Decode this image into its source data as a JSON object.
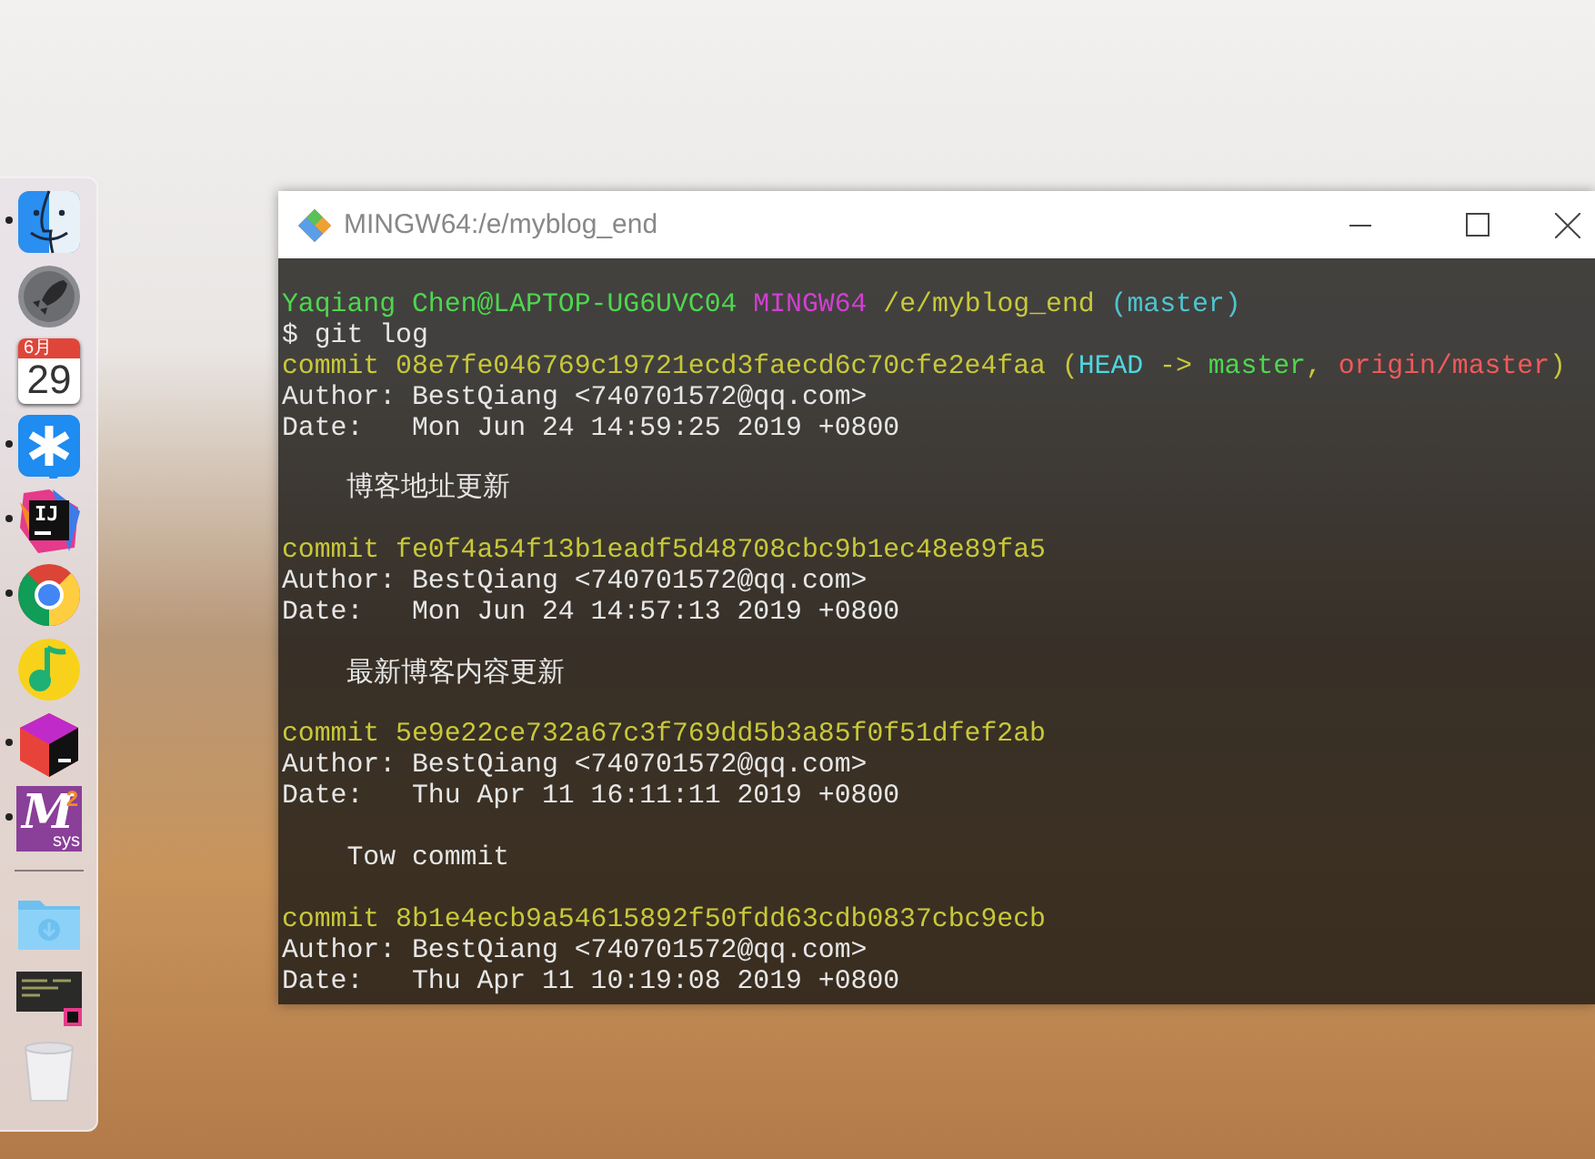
{
  "dock": {
    "items": [
      {
        "kind": "finder",
        "running": true
      },
      {
        "kind": "launchpad",
        "running": false
      },
      {
        "kind": "calendar",
        "running": false,
        "month": "6月",
        "day": "29"
      },
      {
        "kind": "dingtalk",
        "running": true
      },
      {
        "kind": "intellij",
        "running": true,
        "text": "IJ"
      },
      {
        "kind": "chrome",
        "running": true
      },
      {
        "kind": "music",
        "running": false
      },
      {
        "kind": "toolbox",
        "running": true
      },
      {
        "kind": "msys",
        "running": true,
        "text": "M",
        "sup": "2",
        "sub": "sys"
      },
      {
        "kind": "separator"
      },
      {
        "kind": "folder",
        "running": false
      },
      {
        "kind": "thumbnail",
        "running": false
      },
      {
        "kind": "trash",
        "running": false
      }
    ]
  },
  "terminal": {
    "title": "MINGW64:/e/myblog_end",
    "prompt": {
      "user_host": "Yaqiang Chen@LAPTOP-UG6UVC04",
      "system": "MINGW64",
      "path": "/e/myblog_end",
      "branch": "(master)"
    },
    "command": "$ git log",
    "commits": [
      {
        "label": "commit",
        "hash": "08e7fe046769c19721ecd3faecd6c70cfe2e4faa",
        "refs": [
          {
            "kind": "punct",
            "text": " ("
          },
          {
            "kind": "head",
            "text": "HEAD"
          },
          {
            "kind": "punct",
            "text": " -> "
          },
          {
            "kind": "local",
            "text": "master"
          },
          {
            "kind": "punct",
            "text": ", "
          },
          {
            "kind": "remote",
            "text": "origin/master"
          },
          {
            "kind": "punct",
            "text": ")"
          }
        ],
        "author": "Author: BestQiang <740701572@qq.com>",
        "date": "Date:   Mon Jun 24 14:59:25 2019 +0800",
        "message": "博客地址更新"
      },
      {
        "label": "commit",
        "hash": "fe0f4a54f13b1eadf5d48708cbc9b1ec48e89fa5",
        "author": "Author: BestQiang <740701572@qq.com>",
        "date": "Date:   Mon Jun 24 14:57:13 2019 +0800",
        "message": "最新博客内容更新"
      },
      {
        "label": "commit",
        "hash": "5e9e22ce732a67c3f769dd5b3a85f0f51dfef2ab",
        "author": "Author: BestQiang <740701572@qq.com>",
        "date": "Date:   Thu Apr 11 16:11:11 2019 +0800",
        "message": "Tow commit"
      },
      {
        "label": "commit",
        "hash": "8b1e4ecb9a54615892f50fdd63cdb0837cbc9ecb",
        "author": "Author: BestQiang <740701572@qq.com>",
        "date": "Date:   Thu Apr 11 10:19:08 2019 +0800"
      }
    ]
  }
}
